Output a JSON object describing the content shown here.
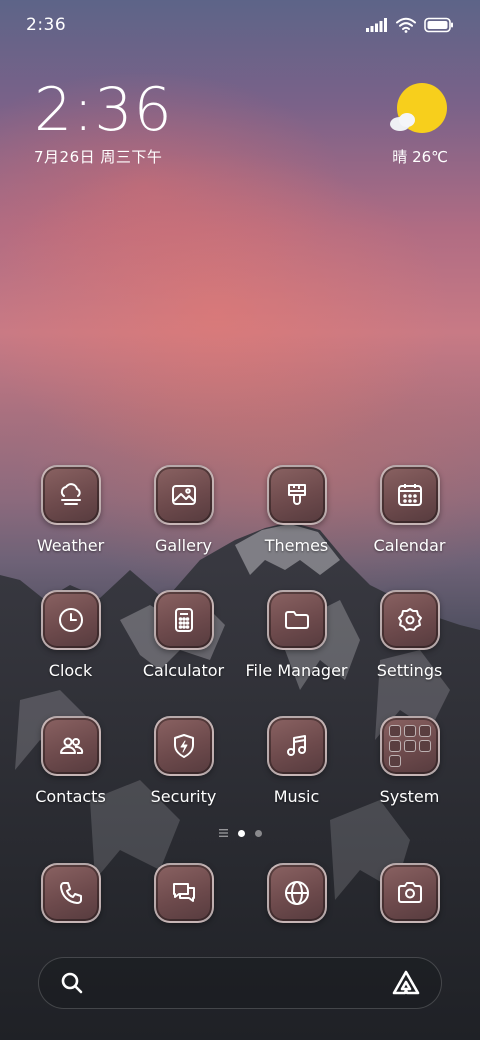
{
  "status_bar": {
    "time": "2:36"
  },
  "clock_widget": {
    "time": "2:36",
    "date": "7月26日 周三下午"
  },
  "weather_widget": {
    "text": "晴 26℃"
  },
  "apps": [
    {
      "label": "Weather",
      "icon": "weather-icon"
    },
    {
      "label": "Gallery",
      "icon": "gallery-icon"
    },
    {
      "label": "Themes",
      "icon": "themes-brush-icon"
    },
    {
      "label": "Calendar",
      "icon": "calendar-icon"
    },
    {
      "label": "Clock",
      "icon": "clock-icon"
    },
    {
      "label": "Calculator",
      "icon": "calculator-icon"
    },
    {
      "label": "File Manager",
      "icon": "folder-icon"
    },
    {
      "label": "Settings",
      "icon": "gear-icon"
    },
    {
      "label": "Contacts",
      "icon": "contacts-icon"
    },
    {
      "label": "Security",
      "icon": "shield-icon"
    },
    {
      "label": "Music",
      "icon": "music-note-icon"
    },
    {
      "label": "System",
      "icon": "folder-grid-icon"
    }
  ],
  "dock": [
    {
      "icon": "phone-icon"
    },
    {
      "icon": "messages-icon"
    },
    {
      "icon": "browser-globe-icon"
    },
    {
      "icon": "camera-icon"
    }
  ],
  "colors": {
    "icon_bg": "#6d4a4c",
    "sun": "#f7cf1c"
  }
}
